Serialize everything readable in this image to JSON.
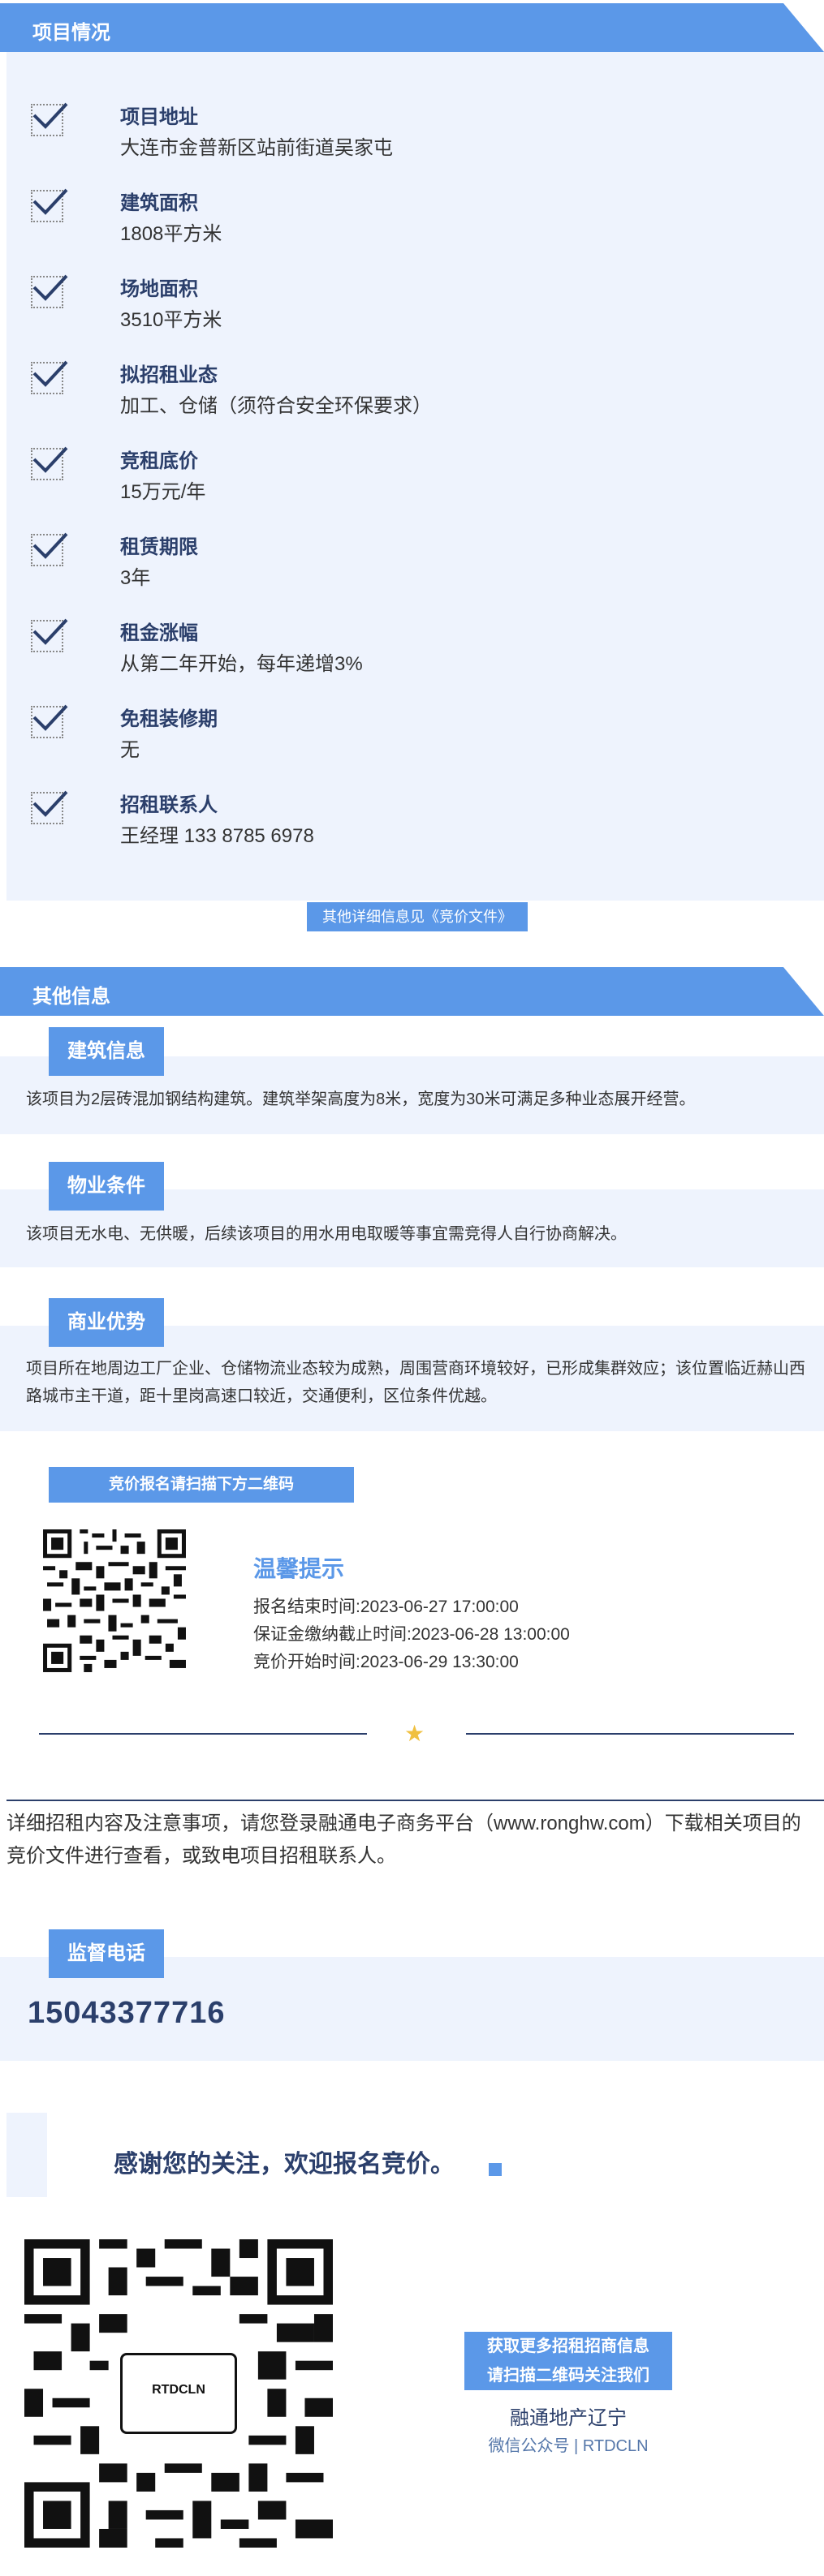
{
  "project": {
    "header": "项目情况",
    "items": [
      {
        "title": "项目地址",
        "value": "大连市金普新区站前街道吴家屯"
      },
      {
        "title": "建筑面积",
        "value": "1808平方米"
      },
      {
        "title": "场地面积",
        "value": "3510平方米"
      },
      {
        "title": "拟招租业态",
        "value": "加工、仓储（须符合安全环保要求）"
      },
      {
        "title": "竞租底价",
        "value": "15万元/年"
      },
      {
        "title": "租赁期限",
        "value": "3年"
      },
      {
        "title": "租金涨幅",
        "value": "从第二年开始，每年递增3%"
      },
      {
        "title": "免租装修期",
        "value": "无"
      },
      {
        "title": "招租联系人",
        "value": "王经理 133 8785 6978"
      }
    ],
    "note": "其他详细信息见《竞价文件》"
  },
  "other": {
    "header": "其他信息",
    "building_tag": "建筑信息",
    "building_text": "该项目为2层砖混加钢结构建筑。建筑举架高度为8米，宽度为30米可满足多种业态展开经营。",
    "property_tag": "物业条件",
    "property_text": "该项目无水电、无供暖，后续该项目的用水用电取暖等事宜需竞得人自行协商解决。",
    "advantage_tag": "商业优势",
    "advantage_text": "项目所在地周边工厂企业、仓储物流业态较为成熟，周围营商环境较好，已形成集群效应；该位置临近赫山西路城市主干道，距十里岗高速口较近，交通便利，区位条件优越。"
  },
  "signup": {
    "banner": "竞价报名请扫描下方二维码",
    "tip_title": "温馨提示",
    "lines": [
      "报名结束时间:2023-06-27 17:00:00",
      "保证金缴纳截止时间:2023-06-28 13:00:00",
      "竞价开始时间:2023-06-29 13:30:00"
    ]
  },
  "detail_paragraph": "详细招租内容及注意事项，请您登录融通电子商务平台（www.ronghw.com）下载相关项目的竞价文件进行查看，或致电项目招租联系人。",
  "supervise": {
    "tag": "监督电话",
    "phone": "15043377716"
  },
  "footer": {
    "thanks": "感谢您的关注，欢迎报名竞价。",
    "cta_line1": "获取更多招租招商信息",
    "cta_line2": "请扫描二维码关注我们",
    "brand_name": "融通地产辽宁",
    "brand_sub": "微信公众号 | RTDCLN",
    "qr_center": "RTDCLN"
  },
  "colors": {
    "accent": "#5b98e8",
    "navy": "#2b3f6b",
    "panel": "#eef3fd"
  }
}
